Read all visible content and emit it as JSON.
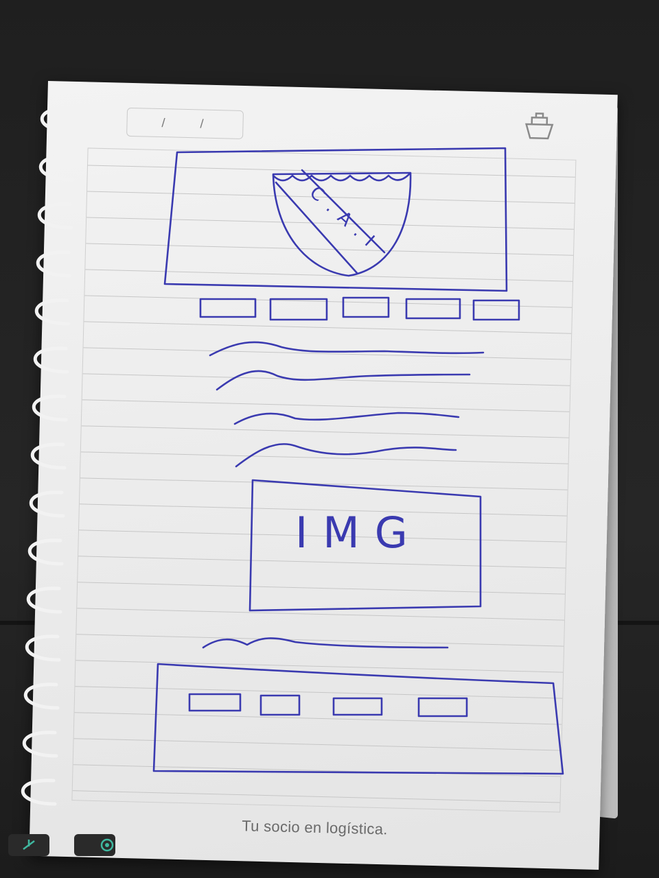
{
  "notebook": {
    "date_separators": [
      "/",
      "/"
    ],
    "tagline": "Tu socio en logística."
  },
  "sketch": {
    "hero": {
      "crest_text": "C.A.I"
    },
    "nav_buttons_count": 5,
    "text_lines_count": 4,
    "image_block": {
      "label": "IMG"
    },
    "footer": {
      "buttons_count": 4
    }
  },
  "colors": {
    "ink": "#3a3ab0",
    "paper": "#efefef",
    "rule": "#c6c6c6",
    "desk": "#1f1f1f"
  },
  "icons": [
    "ship-logo-icon",
    "mic-off-icon",
    "app-icon"
  ]
}
